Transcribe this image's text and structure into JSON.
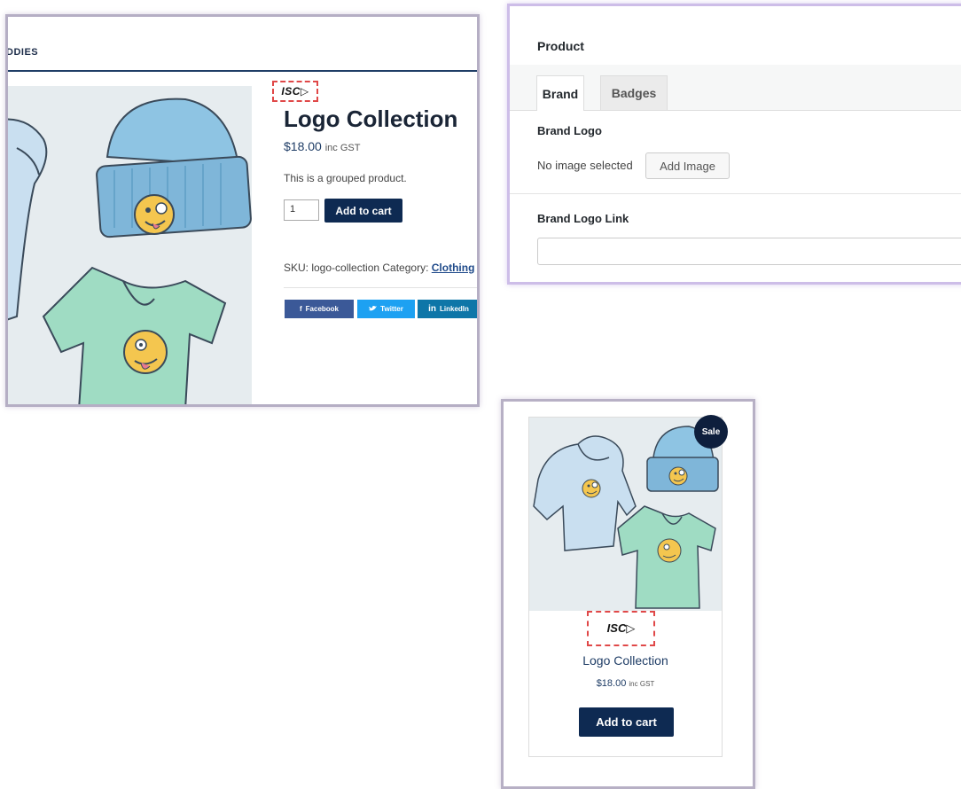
{
  "product_page": {
    "nav_item": "DDIES",
    "brand_logo_text": "ISC▷",
    "title": "Logo Collection",
    "price": "$18.00",
    "price_suffix": "inc GST",
    "description": "This is a grouped product.",
    "quantity_value": "1",
    "add_to_cart_label": "Add to cart",
    "sku_text": "SKU: logo-collection Category:",
    "category_link": "Clothing",
    "share_buttons": [
      {
        "label": "Facebook",
        "icon": "facebook-icon",
        "glyph": "f"
      },
      {
        "label": "Twitter",
        "icon": "twitter-icon",
        "glyph": "🐦"
      },
      {
        "label": "LinkedIn",
        "icon": "linkedin-icon",
        "glyph": "in"
      }
    ]
  },
  "admin_box": {
    "title": "Product",
    "tabs": [
      {
        "label": "Brand",
        "active": true
      },
      {
        "label": "Badges",
        "active": false
      }
    ],
    "brand_logo_label": "Brand Logo",
    "no_image_text": "No image selected",
    "add_image_label": "Add Image",
    "brand_logo_link_label": "Brand Logo Link",
    "brand_logo_link_value": ""
  },
  "product_card": {
    "sale_badge": "Sale",
    "brand_logo_text": "ISC▷",
    "title": "Logo Collection",
    "price": "$18.00",
    "price_suffix": "inc GST",
    "add_to_cart_label": "Add to cart"
  },
  "colors": {
    "navy": "#0e2a52",
    "brand_dashed_border": "#e04848",
    "facebook": "#3b5998",
    "twitter": "#1da1f2",
    "linkedin": "#0e76a8"
  }
}
